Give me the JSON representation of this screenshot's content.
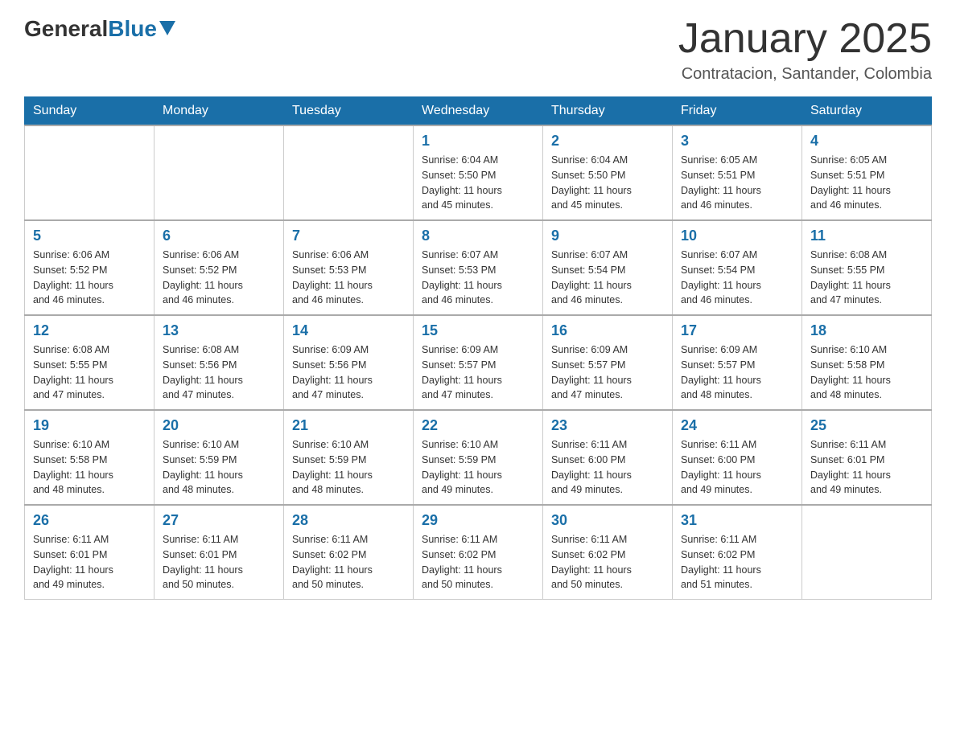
{
  "header": {
    "logo_general": "General",
    "logo_blue": "Blue",
    "title": "January 2025",
    "subtitle": "Contratacion, Santander, Colombia"
  },
  "days_of_week": [
    "Sunday",
    "Monday",
    "Tuesday",
    "Wednesday",
    "Thursday",
    "Friday",
    "Saturday"
  ],
  "weeks": [
    [
      {
        "day": "",
        "info": ""
      },
      {
        "day": "",
        "info": ""
      },
      {
        "day": "",
        "info": ""
      },
      {
        "day": "1",
        "info": "Sunrise: 6:04 AM\nSunset: 5:50 PM\nDaylight: 11 hours\nand 45 minutes."
      },
      {
        "day": "2",
        "info": "Sunrise: 6:04 AM\nSunset: 5:50 PM\nDaylight: 11 hours\nand 45 minutes."
      },
      {
        "day": "3",
        "info": "Sunrise: 6:05 AM\nSunset: 5:51 PM\nDaylight: 11 hours\nand 46 minutes."
      },
      {
        "day": "4",
        "info": "Sunrise: 6:05 AM\nSunset: 5:51 PM\nDaylight: 11 hours\nand 46 minutes."
      }
    ],
    [
      {
        "day": "5",
        "info": "Sunrise: 6:06 AM\nSunset: 5:52 PM\nDaylight: 11 hours\nand 46 minutes."
      },
      {
        "day": "6",
        "info": "Sunrise: 6:06 AM\nSunset: 5:52 PM\nDaylight: 11 hours\nand 46 minutes."
      },
      {
        "day": "7",
        "info": "Sunrise: 6:06 AM\nSunset: 5:53 PM\nDaylight: 11 hours\nand 46 minutes."
      },
      {
        "day": "8",
        "info": "Sunrise: 6:07 AM\nSunset: 5:53 PM\nDaylight: 11 hours\nand 46 minutes."
      },
      {
        "day": "9",
        "info": "Sunrise: 6:07 AM\nSunset: 5:54 PM\nDaylight: 11 hours\nand 46 minutes."
      },
      {
        "day": "10",
        "info": "Sunrise: 6:07 AM\nSunset: 5:54 PM\nDaylight: 11 hours\nand 46 minutes."
      },
      {
        "day": "11",
        "info": "Sunrise: 6:08 AM\nSunset: 5:55 PM\nDaylight: 11 hours\nand 47 minutes."
      }
    ],
    [
      {
        "day": "12",
        "info": "Sunrise: 6:08 AM\nSunset: 5:55 PM\nDaylight: 11 hours\nand 47 minutes."
      },
      {
        "day": "13",
        "info": "Sunrise: 6:08 AM\nSunset: 5:56 PM\nDaylight: 11 hours\nand 47 minutes."
      },
      {
        "day": "14",
        "info": "Sunrise: 6:09 AM\nSunset: 5:56 PM\nDaylight: 11 hours\nand 47 minutes."
      },
      {
        "day": "15",
        "info": "Sunrise: 6:09 AM\nSunset: 5:57 PM\nDaylight: 11 hours\nand 47 minutes."
      },
      {
        "day": "16",
        "info": "Sunrise: 6:09 AM\nSunset: 5:57 PM\nDaylight: 11 hours\nand 47 minutes."
      },
      {
        "day": "17",
        "info": "Sunrise: 6:09 AM\nSunset: 5:57 PM\nDaylight: 11 hours\nand 48 minutes."
      },
      {
        "day": "18",
        "info": "Sunrise: 6:10 AM\nSunset: 5:58 PM\nDaylight: 11 hours\nand 48 minutes."
      }
    ],
    [
      {
        "day": "19",
        "info": "Sunrise: 6:10 AM\nSunset: 5:58 PM\nDaylight: 11 hours\nand 48 minutes."
      },
      {
        "day": "20",
        "info": "Sunrise: 6:10 AM\nSunset: 5:59 PM\nDaylight: 11 hours\nand 48 minutes."
      },
      {
        "day": "21",
        "info": "Sunrise: 6:10 AM\nSunset: 5:59 PM\nDaylight: 11 hours\nand 48 minutes."
      },
      {
        "day": "22",
        "info": "Sunrise: 6:10 AM\nSunset: 5:59 PM\nDaylight: 11 hours\nand 49 minutes."
      },
      {
        "day": "23",
        "info": "Sunrise: 6:11 AM\nSunset: 6:00 PM\nDaylight: 11 hours\nand 49 minutes."
      },
      {
        "day": "24",
        "info": "Sunrise: 6:11 AM\nSunset: 6:00 PM\nDaylight: 11 hours\nand 49 minutes."
      },
      {
        "day": "25",
        "info": "Sunrise: 6:11 AM\nSunset: 6:01 PM\nDaylight: 11 hours\nand 49 minutes."
      }
    ],
    [
      {
        "day": "26",
        "info": "Sunrise: 6:11 AM\nSunset: 6:01 PM\nDaylight: 11 hours\nand 49 minutes."
      },
      {
        "day": "27",
        "info": "Sunrise: 6:11 AM\nSunset: 6:01 PM\nDaylight: 11 hours\nand 50 minutes."
      },
      {
        "day": "28",
        "info": "Sunrise: 6:11 AM\nSunset: 6:02 PM\nDaylight: 11 hours\nand 50 minutes."
      },
      {
        "day": "29",
        "info": "Sunrise: 6:11 AM\nSunset: 6:02 PM\nDaylight: 11 hours\nand 50 minutes."
      },
      {
        "day": "30",
        "info": "Sunrise: 6:11 AM\nSunset: 6:02 PM\nDaylight: 11 hours\nand 50 minutes."
      },
      {
        "day": "31",
        "info": "Sunrise: 6:11 AM\nSunset: 6:02 PM\nDaylight: 11 hours\nand 51 minutes."
      },
      {
        "day": "",
        "info": ""
      }
    ]
  ]
}
